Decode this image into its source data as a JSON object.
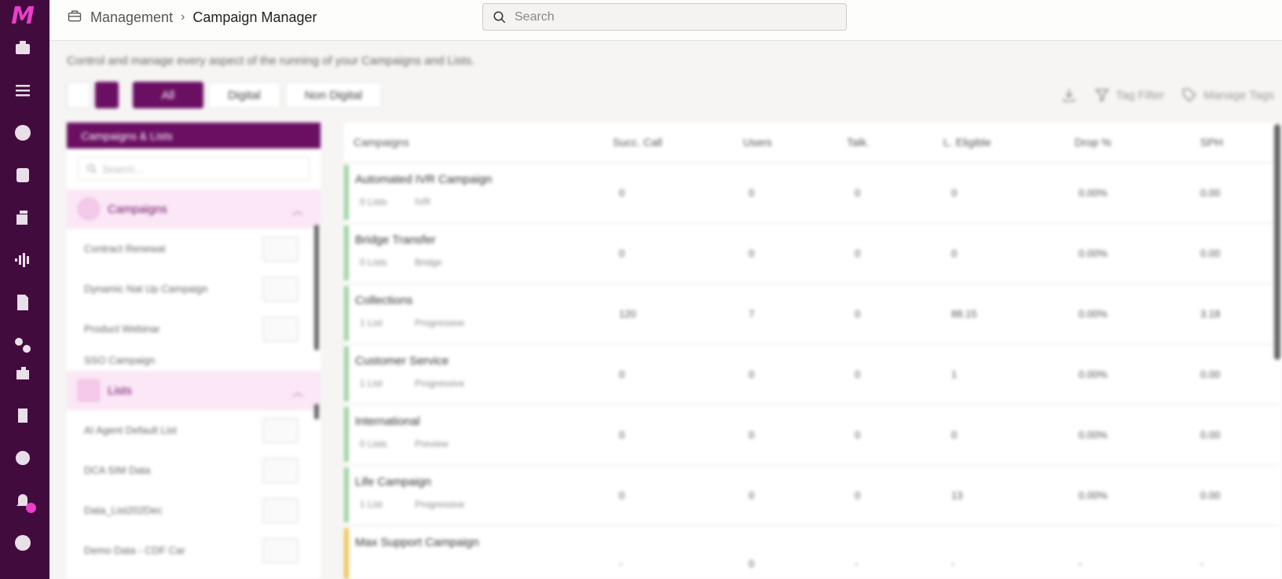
{
  "app": {
    "logo_text": "M",
    "rail_icons": [
      "dashboard-icon",
      "sliders-icon",
      "dollar-icon",
      "database-icon",
      "contacts-icon",
      "waveform-icon",
      "document-icon",
      "connectors-icon",
      "extensions-icon",
      "campaigns-icon",
      "settings-icon",
      "bell-icon",
      "help-icon"
    ]
  },
  "header": {
    "breadcrumb_root": "Management",
    "breadcrumb_sep": "›",
    "breadcrumb_current": "Campaign Manager",
    "search_placeholder": "Search"
  },
  "page": {
    "description": "Control and manage every aspect of the running of your Campaigns and Lists.",
    "filters": [
      "All",
      "Digital",
      "Non Digital"
    ],
    "actions": {
      "tag_filter": "Tag Filter",
      "manage_tags": "Manage Tags"
    }
  },
  "panel": {
    "title": "Campaigns & Lists",
    "search_placeholder": "Search...",
    "groups": [
      {
        "label": "Campaigns",
        "items": [
          "Contract Renewal",
          "Dynamic Nat Up Campaign",
          "Product Webinar",
          "SSO Campaign"
        ]
      },
      {
        "label": "Lists",
        "items": [
          "AI Agent Default List",
          "DCA SIM Data",
          "Data_List202Dec",
          "Demo Data - CDF Car"
        ]
      }
    ]
  },
  "table": {
    "columns": [
      "Campaigns",
      "Succ. Call",
      "Users",
      "Talk.",
      "L. Eligible",
      "Drop %",
      "SPH"
    ],
    "rows": [
      {
        "name": "Automated IVR Campaign",
        "lists": "0 Lists",
        "mode": "IVR",
        "status": "ok",
        "values": [
          "0",
          "0",
          "0",
          "0",
          "0.00%",
          "0.00"
        ]
      },
      {
        "name": "Bridge Transfer",
        "lists": "0 Lists",
        "mode": "Bridge",
        "status": "ok",
        "values": [
          "0",
          "0",
          "0",
          "0",
          "0.00%",
          "0.00"
        ]
      },
      {
        "name": "Collections",
        "lists": "1 List",
        "mode": "Progressive",
        "status": "ok",
        "values": [
          "120",
          "7",
          "0",
          "88.15",
          "0.00%",
          "3.18"
        ]
      },
      {
        "name": "Customer Service",
        "lists": "1 List",
        "mode": "Progressive",
        "status": "ok",
        "values": [
          "0",
          "0",
          "0",
          "1",
          "0.00%",
          "0.00"
        ]
      },
      {
        "name": "International",
        "lists": "0 Lists",
        "mode": "Preview",
        "status": "ok",
        "values": [
          "0",
          "0",
          "0",
          "0",
          "0.00%",
          "0.00"
        ]
      },
      {
        "name": "Life Campaign",
        "lists": "1 List",
        "mode": "Progressive",
        "status": "ok",
        "values": [
          "0",
          "0",
          "0",
          "13",
          "0.00%",
          "0.00"
        ]
      },
      {
        "name": "Max Support Campaign",
        "lists": "",
        "mode": "",
        "status": "warn",
        "values": [
          "-",
          "0",
          "-",
          "-",
          "-",
          "-"
        ]
      }
    ]
  }
}
